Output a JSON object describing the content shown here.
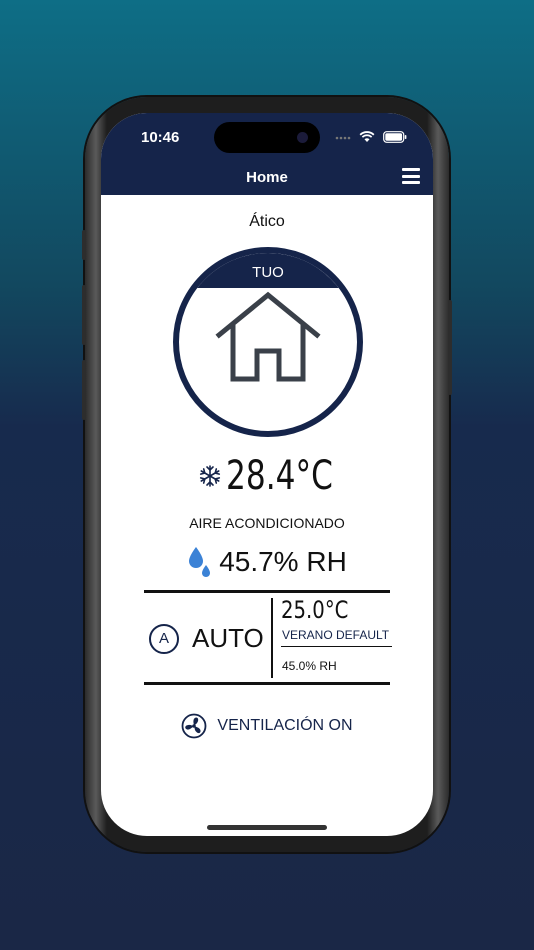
{
  "status_bar": {
    "time": "10:46"
  },
  "nav": {
    "title": "Home"
  },
  "zone": {
    "name": "Ático",
    "badge": "TUO"
  },
  "current": {
    "temperature": "28.4°C",
    "mode": "AIRE ACONDICIONADO",
    "humidity": "45.7% RH"
  },
  "control": {
    "mode_icon_letter": "A",
    "mode": "AUTO",
    "setpoint_temperature": "25.0°C",
    "profile": "VERANO DEFAULT",
    "setpoint_humidity": "45.0% RH"
  },
  "ventilation": {
    "label": "VENTILACIÓN ON"
  },
  "colors": {
    "navy": "#15244a",
    "drop": "#3b82d6",
    "text": "#111111"
  },
  "icons": [
    "signal-icon",
    "wifi-icon",
    "battery-icon",
    "menu-icon",
    "house-icon",
    "snowflake-icon",
    "water-drop-icon",
    "auto-mode-icon",
    "fan-icon"
  ]
}
